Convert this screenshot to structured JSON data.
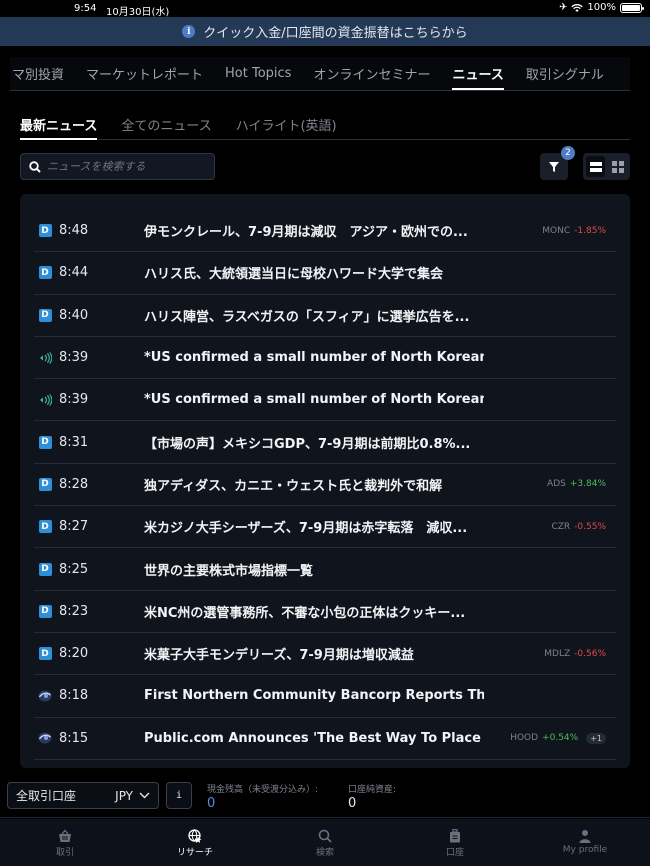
{
  "status_bar": {
    "time": "9:54",
    "date": "10月30日(水)",
    "battery": "100%"
  },
  "banner": {
    "text": "クイック入金/口座間の資金振替はこちらから"
  },
  "top_tabs": [
    {
      "label": "マ別投資",
      "active": false
    },
    {
      "label": "マーケットレポート",
      "active": false
    },
    {
      "label": "Hot Topics",
      "active": false
    },
    {
      "label": "オンラインセミナー",
      "active": false
    },
    {
      "label": "ニュース",
      "active": true
    },
    {
      "label": "取引シグナル",
      "active": false
    }
  ],
  "sub_tabs": [
    {
      "label": "最新ニュース",
      "active": true
    },
    {
      "label": "全てのニュース",
      "active": false
    },
    {
      "label": "ハイライト(英語)",
      "active": false
    }
  ],
  "search": {
    "placeholder": "ニュースを検索する",
    "value": ""
  },
  "filter": {
    "badge_count": "2"
  },
  "view_mode": "list",
  "news": [
    {
      "source": "dj",
      "time": "8:48",
      "title": "伊モンクレール、7-9月期は減収　アジア・欧州での...",
      "symbol": "MONC",
      "change": "-1.85%",
      "direction": "neg",
      "more": ""
    },
    {
      "source": "dj",
      "time": "8:44",
      "title": "ハリス氏、大統領選当日に母校ハワード大学で集会",
      "symbol": "",
      "change": "",
      "direction": "",
      "more": ""
    },
    {
      "source": "dj",
      "time": "8:40",
      "title": "ハリス陣営、ラスベガスの「スフィア」に選挙広告を...",
      "symbol": "",
      "change": "",
      "direction": "",
      "more": ""
    },
    {
      "source": "squawk",
      "time": "8:39",
      "title": "*US confirmed a small number of North Korean tr...",
      "symbol": "",
      "change": "",
      "direction": "",
      "more": ""
    },
    {
      "source": "squawk",
      "time": "8:39",
      "title": "*US confirmed a small number of North Korean tr...",
      "symbol": "",
      "change": "",
      "direction": "",
      "more": ""
    },
    {
      "source": "dj",
      "time": "8:31",
      "title": "【市場の声】メキシコGDP、7-9月期は前期比0.8%...",
      "symbol": "",
      "change": "",
      "direction": "",
      "more": ""
    },
    {
      "source": "dj",
      "time": "8:28",
      "title": "独アディダス、カニエ・ウェスト氏と裁判外で和解",
      "symbol": "ADS",
      "change": "+3.84%",
      "direction": "pos",
      "more": ""
    },
    {
      "source": "dj",
      "time": "8:27",
      "title": "米カジノ大手シーザーズ、7-9月期は赤字転落　減収...",
      "symbol": "CZR",
      "change": "-0.55%",
      "direction": "neg",
      "more": ""
    },
    {
      "source": "dj",
      "time": "8:25",
      "title": "世界の主要株式市場指標一覧",
      "symbol": "",
      "change": "",
      "direction": "",
      "more": ""
    },
    {
      "source": "dj",
      "time": "8:23",
      "title": "米NC州の選管事務所、不審な小包の正体はクッキー...",
      "symbol": "",
      "change": "",
      "direction": "",
      "more": ""
    },
    {
      "source": "dj",
      "time": "8:20",
      "title": "米菓子大手モンデリーズ、7-9月期は増収減益",
      "symbol": "MDLZ",
      "change": "-0.56%",
      "direction": "neg",
      "more": ""
    },
    {
      "source": "globe",
      "time": "8:18",
      "title": "First Northern Community Bancorp Reports Third ...",
      "symbol": "",
      "change": "",
      "direction": "",
      "more": ""
    },
    {
      "source": "globe",
      "time": "8:15",
      "title": "Public.com Announces 'The Best Way To Place A ...",
      "symbol": "HOOD",
      "change": "+0.54%",
      "direction": "pos",
      "more": "+1"
    }
  ],
  "account_bar": {
    "account": "全取引口座",
    "currency": "JPY",
    "info_label": "i",
    "cash_label": "現金残高（未受渡分込み）:",
    "cash_value": "0",
    "net_label": "口座純資産:",
    "net_value": "0"
  },
  "bottom_nav": [
    {
      "label": "取引",
      "icon": "basket-icon",
      "active": false
    },
    {
      "label": "リサーチ",
      "icon": "globe-star-icon",
      "active": true
    },
    {
      "label": "検索",
      "icon": "search-icon",
      "active": false
    },
    {
      "label": "口座",
      "icon": "briefcase-icon",
      "active": false
    },
    {
      "label": "My profile",
      "icon": "person-icon",
      "active": false
    }
  ],
  "colors": {
    "accent_blue": "#4f7cc5",
    "negative": "#e0484a",
    "positive": "#4cbc5c",
    "banner_bg": "#243955"
  }
}
